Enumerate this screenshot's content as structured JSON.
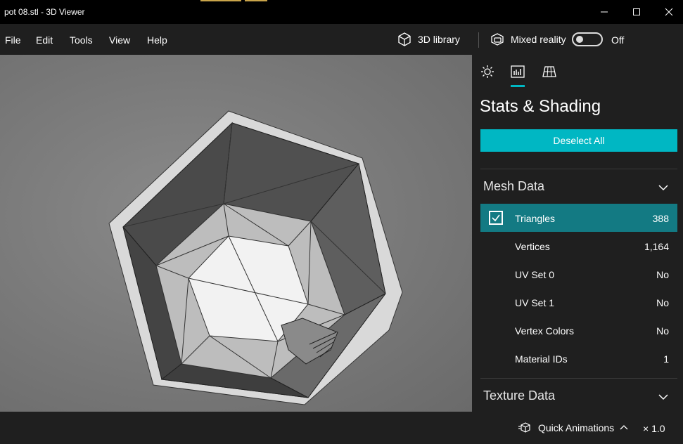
{
  "window": {
    "title": "pot 08.stl - 3D Viewer"
  },
  "menu": {
    "items": [
      "File",
      "Edit",
      "Tools",
      "View",
      "Help"
    ]
  },
  "toolbar": {
    "library_label": "3D library",
    "mixed_reality_label": "Mixed reality",
    "mixed_reality_state": "Off"
  },
  "panel": {
    "tabs": [
      "lighting-tab",
      "stats-tab",
      "grid-tab"
    ],
    "title": "Stats & Shading",
    "deselect_label": "Deselect All",
    "mesh_section": "Mesh Data",
    "mesh_rows": [
      {
        "label": "Triangles",
        "value": "388",
        "checked": true
      },
      {
        "label": "Vertices",
        "value": "1,164"
      },
      {
        "label": "UV Set 0",
        "value": "No"
      },
      {
        "label": "UV Set 1",
        "value": "No"
      },
      {
        "label": "Vertex Colors",
        "value": "No"
      },
      {
        "label": "Material IDs",
        "value": "1"
      }
    ],
    "texture_section": "Texture Data"
  },
  "bottom": {
    "quick_animations": "Quick Animations",
    "speed": "× 1.0"
  },
  "colors": {
    "accent": "#00b7c3",
    "selected_row": "#137a83",
    "panel_bg": "#1f1f1f"
  }
}
